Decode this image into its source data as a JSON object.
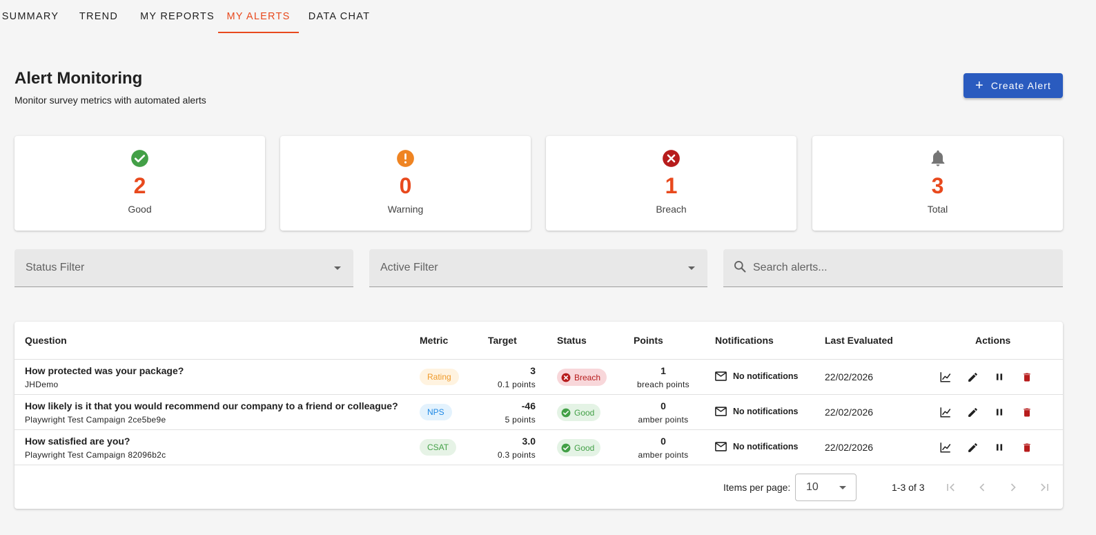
{
  "tabs": [
    {
      "label": "SUMMARY"
    },
    {
      "label": "TREND"
    },
    {
      "label": "MY REPORTS"
    },
    {
      "label": "MY ALERTS",
      "active": true
    },
    {
      "label": "DATA CHAT"
    }
  ],
  "header": {
    "title": "Alert Monitoring",
    "subtitle": "Monitor survey metrics with automated alerts",
    "create_label": "Create Alert"
  },
  "stats": [
    {
      "value": "2",
      "label": "Good",
      "icon": "check-circle-icon",
      "color": "#43a047"
    },
    {
      "value": "0",
      "label": "Warning",
      "icon": "exclamation-circle-icon",
      "color": "#ef8422"
    },
    {
      "value": "1",
      "label": "Breach",
      "icon": "x-circle-icon",
      "color": "#b71c1c"
    },
    {
      "value": "3",
      "label": "Total",
      "icon": "bell-icon",
      "color": "#757575"
    }
  ],
  "filters": {
    "status_label": "Status Filter",
    "active_label": "Active Filter",
    "search_placeholder": "Search alerts..."
  },
  "table": {
    "columns": [
      "Question",
      "Metric",
      "Target",
      "Status",
      "Points",
      "Notifications",
      "Last Evaluated",
      "Actions"
    ],
    "rows": [
      {
        "question": "How protected was your package?",
        "campaign": "JHDemo",
        "metric": "Rating",
        "target": "3",
        "target_sub": "0.1 points",
        "status": "Breach",
        "points": "1",
        "points_sub": "breach points",
        "notifications": "No notifications",
        "last_evaluated": "22/02/2026"
      },
      {
        "question": "How likely is it that you would recommend our company to a friend or colleague?",
        "campaign": "Playwright Test Campaign 2ce5be9e",
        "metric": "NPS",
        "target": "-46",
        "target_sub": "5 points",
        "status": "Good",
        "points": "0",
        "points_sub": "amber points",
        "notifications": "No notifications",
        "last_evaluated": "22/02/2026"
      },
      {
        "question": "How satisfied are you?",
        "campaign": "Playwright Test Campaign 82096b2c",
        "metric": "CSAT",
        "target": "3.0",
        "target_sub": "0.3 points",
        "status": "Good",
        "points": "0",
        "points_sub": "amber points",
        "notifications": "No notifications",
        "last_evaluated": "22/02/2026"
      }
    ]
  },
  "paginator": {
    "items_label": "Items per page:",
    "page_size": "10",
    "range": "1-3 of 3"
  },
  "colors": {
    "accent": "#e8491d",
    "primary": "#2a5bbf",
    "breach": "#b71c1c",
    "good": "#43a047"
  }
}
